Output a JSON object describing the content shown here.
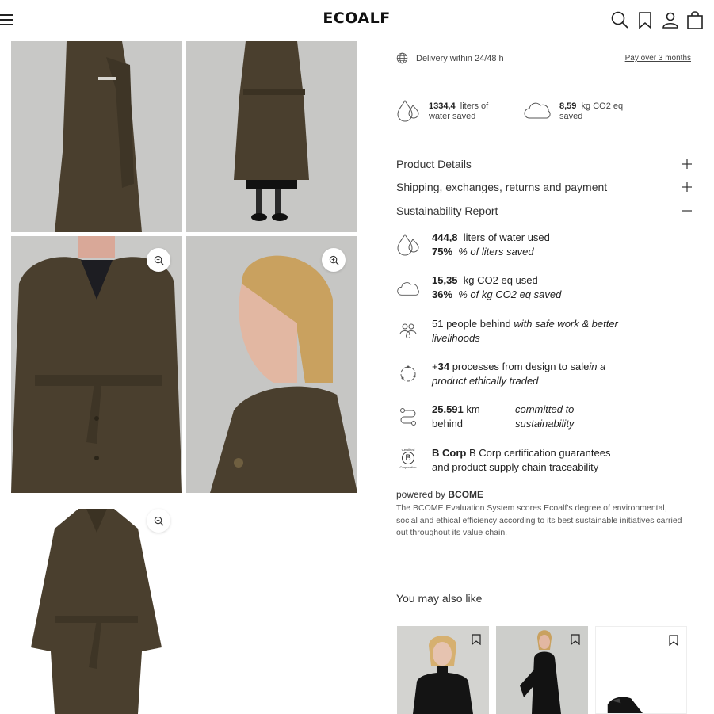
{
  "header": {
    "logo": "ECOALF",
    "icons": [
      "menu-icon",
      "search-icon",
      "bookmark-icon",
      "user-icon",
      "bag-icon"
    ]
  },
  "delivery": {
    "text": "Delivery within 24/48 h",
    "link": "Pay over 3 months"
  },
  "savings": [
    {
      "value": "1334,4",
      "unit": "liters of",
      "unit2": "water saved",
      "icon": "water-drop-icon"
    },
    {
      "value": "8,59",
      "unit": "kg CO2 eq",
      "unit2": "saved",
      "icon": "cloud-icon"
    }
  ],
  "accordion": [
    {
      "label": "Product Details",
      "state": "collapsed"
    },
    {
      "label": "Shipping, exchanges, returns and payment",
      "state": "collapsed"
    },
    {
      "label": "Sustainability Report",
      "state": "expanded"
    }
  ],
  "report": {
    "water": {
      "value": "444,8",
      "text": "liters of water used",
      "pct": "75%",
      "pct_text": "% of liters saved"
    },
    "co2": {
      "value": "15,35",
      "text": "kg CO2 eq used",
      "pct": "36%",
      "pct_text": "% of kg CO2 eq saved"
    },
    "people": {
      "text": "51 people behind",
      "italic": "with safe work & better livelihoods"
    },
    "processes": {
      "prefix": "+",
      "value": "34",
      "text": "processes from design to sale",
      "italic": "in a product ethically traded"
    },
    "distance": {
      "value": "25.591",
      "unit": "km",
      "text": "behind",
      "italic": "committed to sustainability"
    },
    "bcorp": {
      "bold": "B Corp",
      "text": "B Corp certification guarantees and product supply chain traceability",
      "badge_top": "Certified",
      "badge_letter": "B",
      "badge_bottom": "Corporation"
    }
  },
  "powered": {
    "prefix": "powered by",
    "brand": "BCOME"
  },
  "bcome_description": "The BCOME Evaluation System scores Ecoalf's degree of environmental, social and ethical efficiency according to its best sustainable initiatives carried out throughout its value chain.",
  "also_like": {
    "title": "You may also like"
  },
  "colors": {
    "coat": "#4a3f2e",
    "wall": "#c9c9c7",
    "text": "#222222"
  }
}
